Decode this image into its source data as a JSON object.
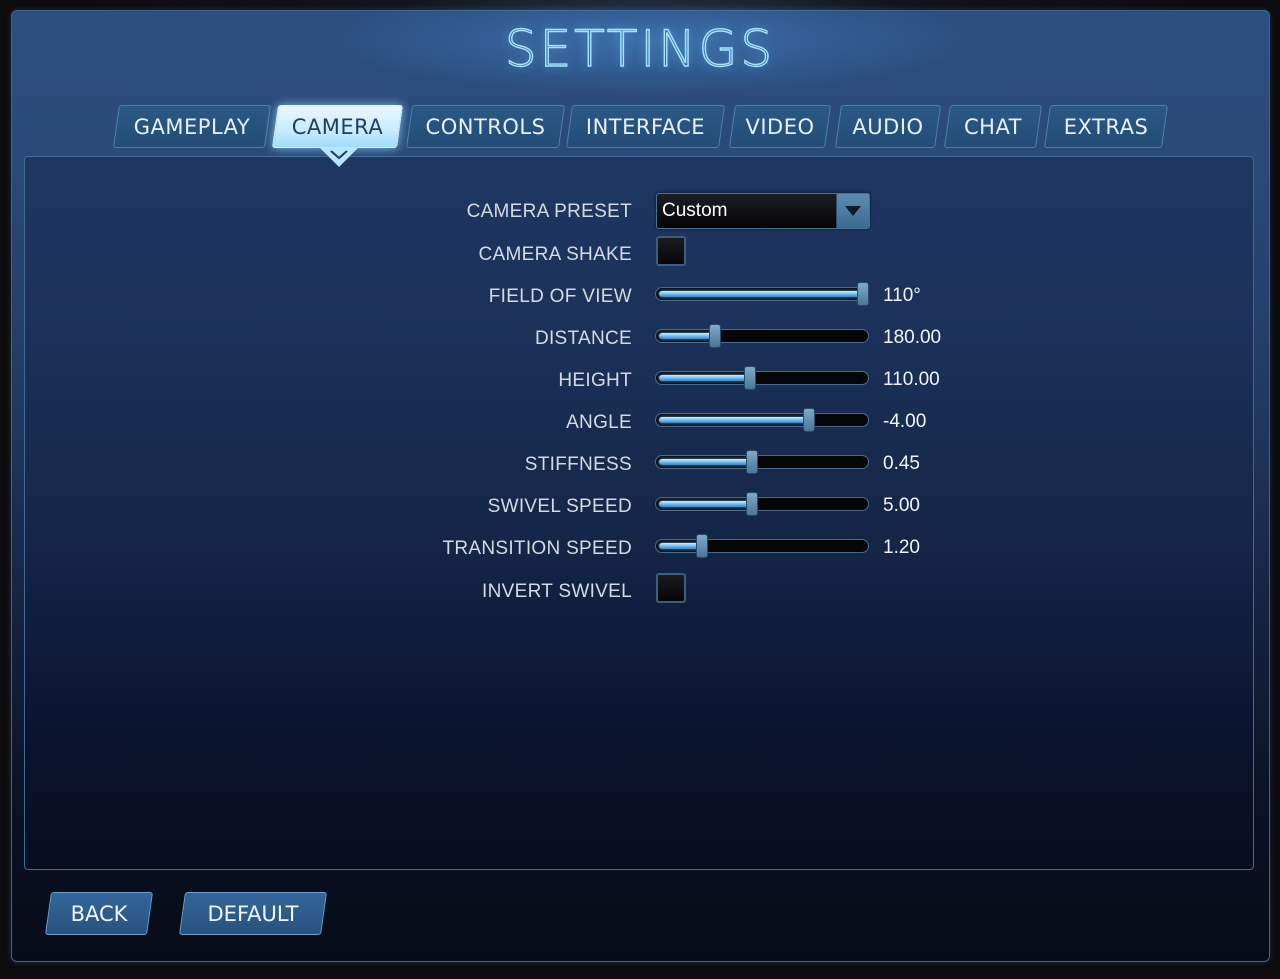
{
  "title": "SETTINGS",
  "tabs": [
    {
      "label": "GAMEPLAY",
      "active": false
    },
    {
      "label": "CAMERA",
      "active": true
    },
    {
      "label": "CONTROLS",
      "active": false
    },
    {
      "label": "INTERFACE",
      "active": false
    },
    {
      "label": "VIDEO",
      "active": false
    },
    {
      "label": "AUDIO",
      "active": false
    },
    {
      "label": "CHAT",
      "active": false
    },
    {
      "label": "EXTRAS",
      "active": false
    }
  ],
  "settings": {
    "camera_preset": {
      "label": "CAMERA PRESET",
      "value": "Custom"
    },
    "camera_shake": {
      "label": "CAMERA SHAKE",
      "checked": false
    },
    "field_of_view": {
      "label": "FIELD OF VIEW",
      "value": "110°",
      "fraction": 0.99
    },
    "distance": {
      "label": "DISTANCE",
      "value": "180.00",
      "fraction": 0.27
    },
    "height": {
      "label": "HEIGHT",
      "value": "110.00",
      "fraction": 0.44
    },
    "angle": {
      "label": "ANGLE",
      "value": "-4.00",
      "fraction": 0.73
    },
    "stiffness": {
      "label": "STIFFNESS",
      "value": "0.45",
      "fraction": 0.45
    },
    "swivel_speed": {
      "label": "SWIVEL SPEED",
      "value": "5.00",
      "fraction": 0.45
    },
    "transition_speed": {
      "label": "TRANSITION SPEED",
      "value": "1.20",
      "fraction": 0.21
    },
    "invert_swivel": {
      "label": "INVERT SWIVEL",
      "checked": false
    }
  },
  "buttons": {
    "back": "BACK",
    "default": "DEFAULT"
  },
  "colors": {
    "accent": "#a8e4ff",
    "active_tab": "#c6ecff",
    "panel": "#1e3761"
  }
}
